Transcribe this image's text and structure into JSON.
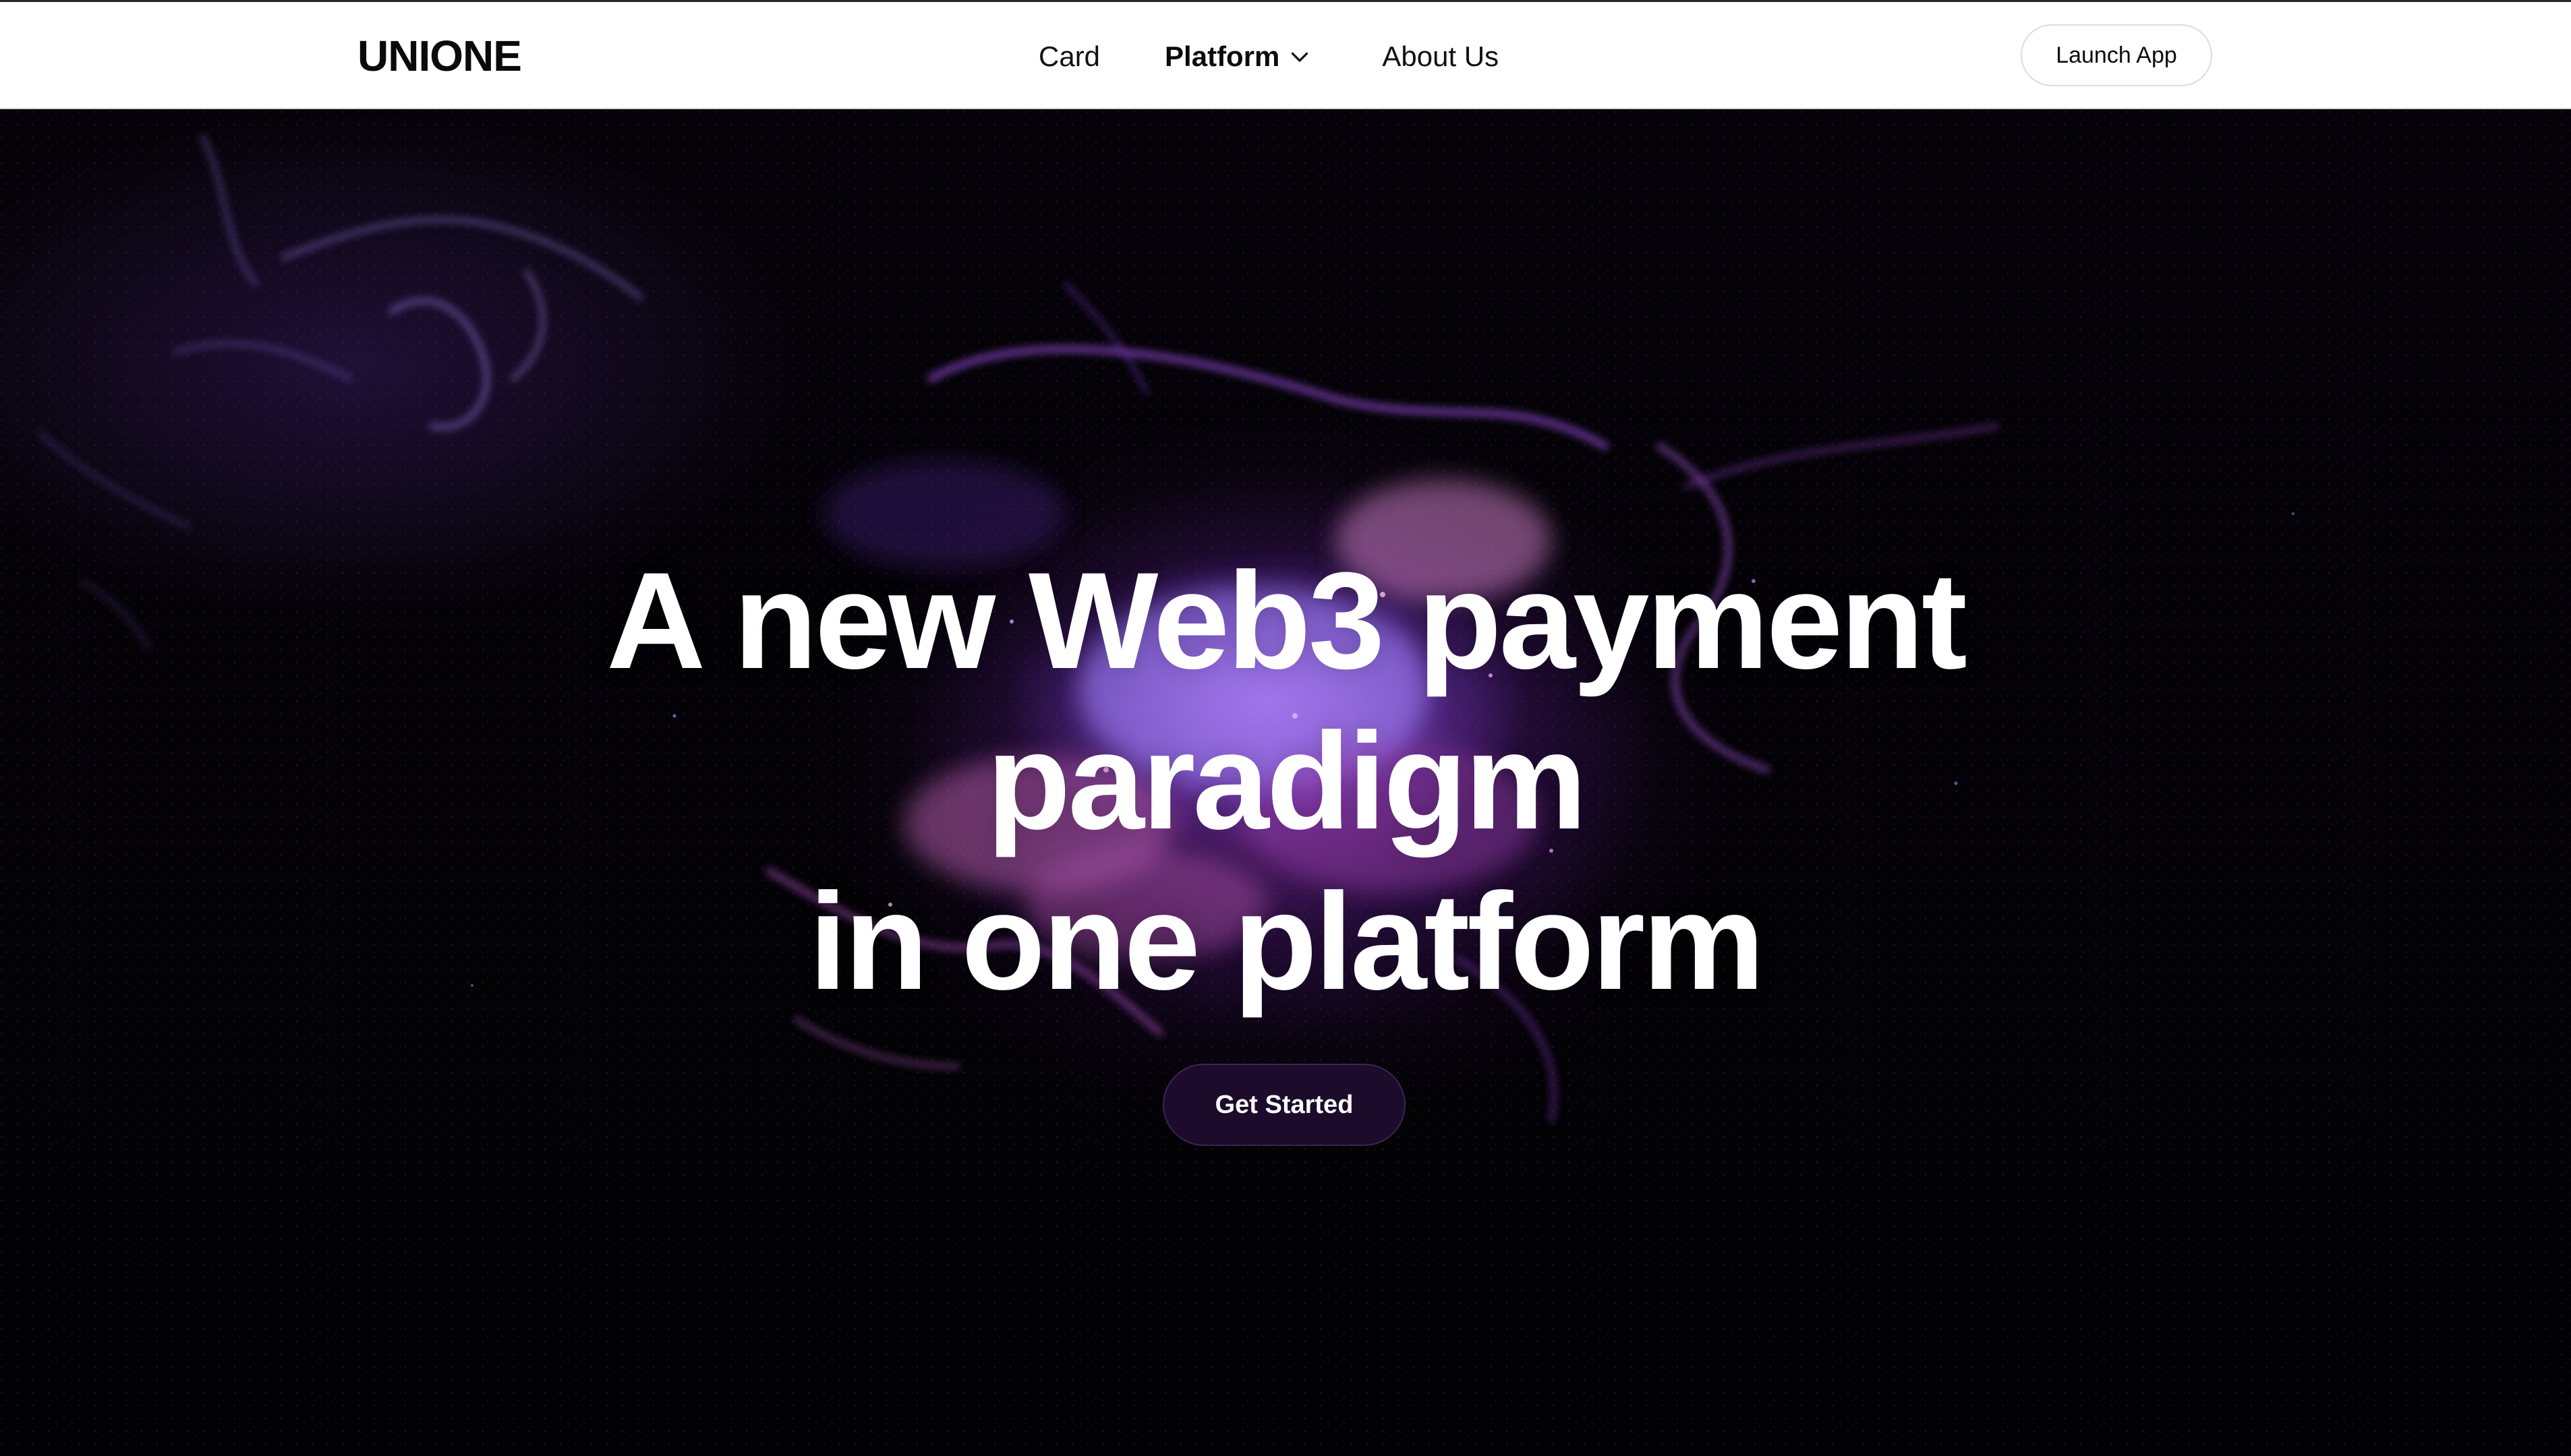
{
  "header": {
    "logo": "UNIONE",
    "nav": {
      "card": "Card",
      "platform": "Platform",
      "about": "About Us"
    },
    "launch_button": "Launch App"
  },
  "hero": {
    "headline_line1": "A new Web3 payment",
    "headline_line2": "paradigm",
    "headline_line3": "in one platform",
    "cta_label": "Get Started"
  },
  "colors": {
    "nav_background": "#ffffff",
    "hero_background": "#030205",
    "cta_background": "#1c0b2b",
    "particle_purple": "#b678f0",
    "particle_pink": "#e39ad9"
  },
  "icons": {
    "platform_dropdown": "chevron-down-icon"
  }
}
